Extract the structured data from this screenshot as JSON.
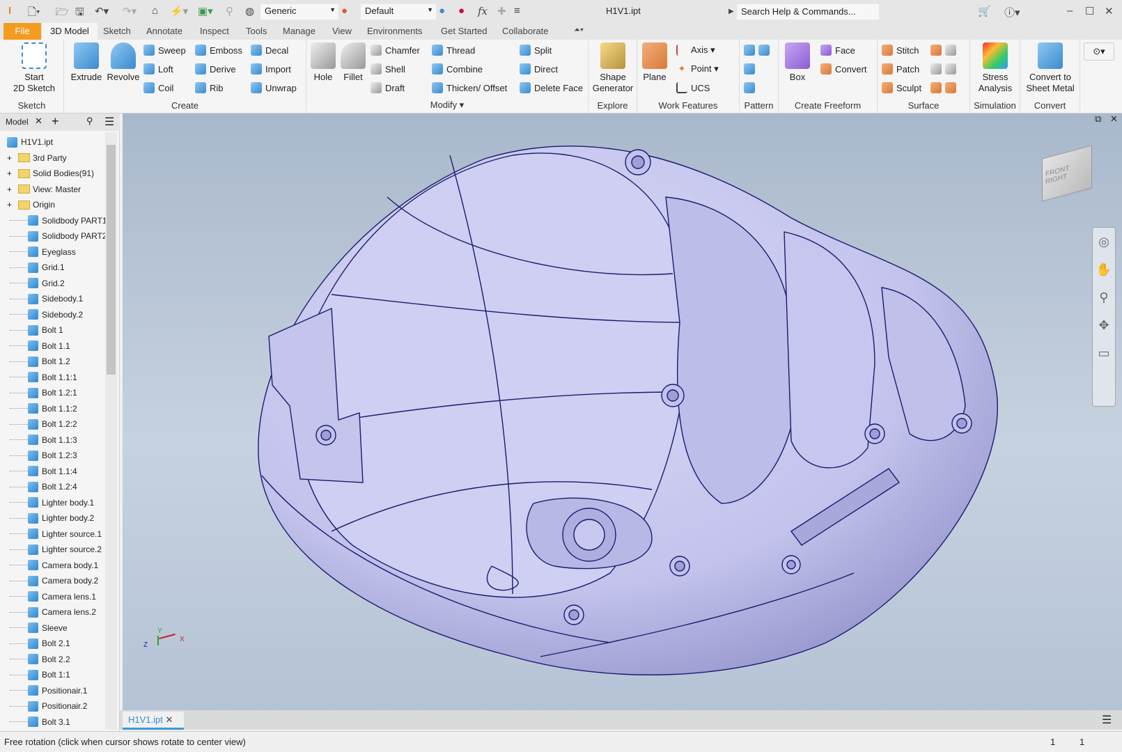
{
  "titlebar": {
    "app_icon": "inventor-pro-logo",
    "material": "Generic",
    "appearance": "Default",
    "fx": "fx",
    "document_title": "H1V1.ipt",
    "search_placeholder": "Search Help & Commands..."
  },
  "tabs": [
    {
      "label": "File"
    },
    {
      "label": "3D Model",
      "active": true
    },
    {
      "label": "Sketch"
    },
    {
      "label": "Annotate"
    },
    {
      "label": "Inspect"
    },
    {
      "label": "Tools"
    },
    {
      "label": "Manage"
    },
    {
      "label": "View"
    },
    {
      "label": "Environments"
    },
    {
      "label": "Get Started"
    },
    {
      "label": "Collaborate"
    }
  ],
  "ribbon": {
    "sketch": {
      "label": "Sketch",
      "start": "Start",
      "start2": "2D Sketch"
    },
    "create": {
      "label": "Create",
      "extrude": "Extrude",
      "revolve": "Revolve",
      "sweep": "Sweep",
      "loft": "Loft",
      "coil": "Coil",
      "emboss": "Emboss",
      "derive": "Derive",
      "rib": "Rib",
      "decal": "Decal",
      "import": "Import",
      "unwrap": "Unwrap"
    },
    "modify": {
      "label": "Modify ▾",
      "hole": "Hole",
      "fillet": "Fillet",
      "chamfer": "Chamfer",
      "shell": "Shell",
      "draft": "Draft",
      "thread": "Thread",
      "combine": "Combine",
      "thicken": "Thicken/ Offset",
      "split": "Split",
      "direct": "Direct",
      "delete_face": "Delete Face"
    },
    "explore": {
      "label": "Explore",
      "shape1": "Shape",
      "shape2": "Generator"
    },
    "work": {
      "label": "Work Features",
      "plane": "Plane",
      "axis": "Axis ▾",
      "point": "Point ▾",
      "ucs": "UCS"
    },
    "pattern": {
      "label": "Pattern"
    },
    "freeform": {
      "label": "Create Freeform",
      "box": "Box",
      "face": "Face",
      "convert": "Convert"
    },
    "surface": {
      "label": "Surface",
      "stitch": "Stitch",
      "patch": "Patch",
      "sculpt": "Sculpt"
    },
    "simulation": {
      "label": "Simulation",
      "stress1": "Stress",
      "stress2": "Analysis"
    },
    "convert": {
      "label": "Convert",
      "c1": "Convert to",
      "c2": "Sheet Metal"
    }
  },
  "browser": {
    "tab": "Model",
    "root": "H1V1.ipt",
    "folders": [
      "3rd Party",
      "Solid Bodies(91)",
      "View: Master",
      "Origin"
    ],
    "bodies": [
      "Solidbody PART1",
      "Solidbody PART2",
      "Eyeglass",
      "Grid.1",
      "Grid.2",
      "Sidebody.1",
      "Sidebody.2",
      "Bolt 1",
      "Bolt 1.1",
      "Bolt 1.2",
      "Bolt 1.1:1",
      "Bolt 1.2:1",
      "Bolt 1.1:2",
      "Bolt 1.2:2",
      "Bolt 1.1:3",
      "Bolt 1.2:3",
      "Bolt 1.1:4",
      "Bolt 1.2:4",
      "Lighter body.1",
      "Lighter body.2",
      "Lighter source.1",
      "Lighter source.2",
      "Camera body.1",
      "Camera body.2",
      "Camera lens.1",
      "Camera lens.2",
      "Sleeve",
      "Bolt 2.1",
      "Bolt 2.2",
      "Bolt 1:1",
      "Positionair.1",
      "Positionair.2",
      "Bolt 3.1"
    ]
  },
  "viewcube": {
    "front": "FRONT",
    "right": "RIGHT"
  },
  "triad": {
    "x": "X",
    "y": "Y",
    "z": "Z"
  },
  "document_tab": "H1V1.ipt",
  "status": {
    "message": "Free rotation (click when cursor shows rotate to center view)",
    "count1": "1",
    "count2": "1"
  },
  "colors": {
    "file_tab": "#f39c1f",
    "model_fill": "#c9c9ef",
    "edge": "#1a1a6e",
    "accent": "#3a8ad0"
  }
}
